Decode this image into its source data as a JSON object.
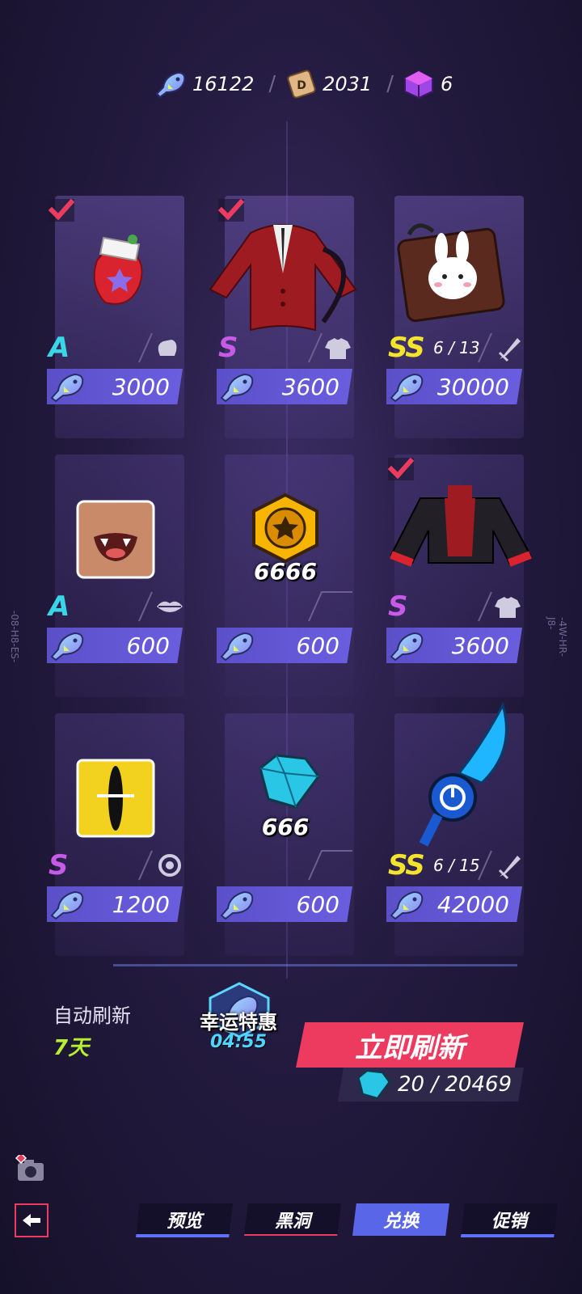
{
  "currencies": {
    "fish": "16122",
    "dice": "2031",
    "cube": "6"
  },
  "items": [
    {
      "rank": "A",
      "price": "3000",
      "checked": true,
      "type": "glove-icon",
      "count": ""
    },
    {
      "rank": "S",
      "price": "3600",
      "checked": true,
      "type": "shirt-icon",
      "count": ""
    },
    {
      "rank": "SS",
      "price": "30000",
      "checked": false,
      "type": "sword-icon",
      "count": "6 / 13"
    },
    {
      "rank": "A",
      "price": "600",
      "checked": false,
      "type": "lips-icon",
      "count": ""
    },
    {
      "rank": "",
      "price": "600",
      "checked": false,
      "type": "",
      "count": "",
      "qty": "6666"
    },
    {
      "rank": "S",
      "price": "3600",
      "checked": true,
      "type": "shirt-icon",
      "count": ""
    },
    {
      "rank": "S",
      "price": "1200",
      "checked": false,
      "type": "ring-icon",
      "count": ""
    },
    {
      "rank": "",
      "price": "600",
      "checked": false,
      "type": "",
      "count": "",
      "qty": "666"
    },
    {
      "rank": "SS",
      "price": "42000",
      "checked": false,
      "type": "sword-icon",
      "count": "6 / 15"
    }
  ],
  "bottom": {
    "auto_refresh_label": "自动刷新",
    "auto_refresh_days": "7天",
    "lucky_title": "幸运特惠",
    "lucky_timer": "04:55",
    "refresh_button": "立即刷新",
    "refresh_cost": "20 / 20469"
  },
  "nav": {
    "preview": "预览",
    "blackhole": "黑洞",
    "exchange": "兑换",
    "promo": "促销"
  },
  "side_text": {
    "left": "-08-H8-ES-",
    "right": "-4W-HR-J8-"
  },
  "colors": {
    "accent_red": "#ec3b5e",
    "price_bar": "#5b50c8",
    "rank_A": "#38d6e6",
    "rank_S": "#c75ae6",
    "rank_SS": "#f5e42a",
    "days_green": "#b5f02e"
  }
}
